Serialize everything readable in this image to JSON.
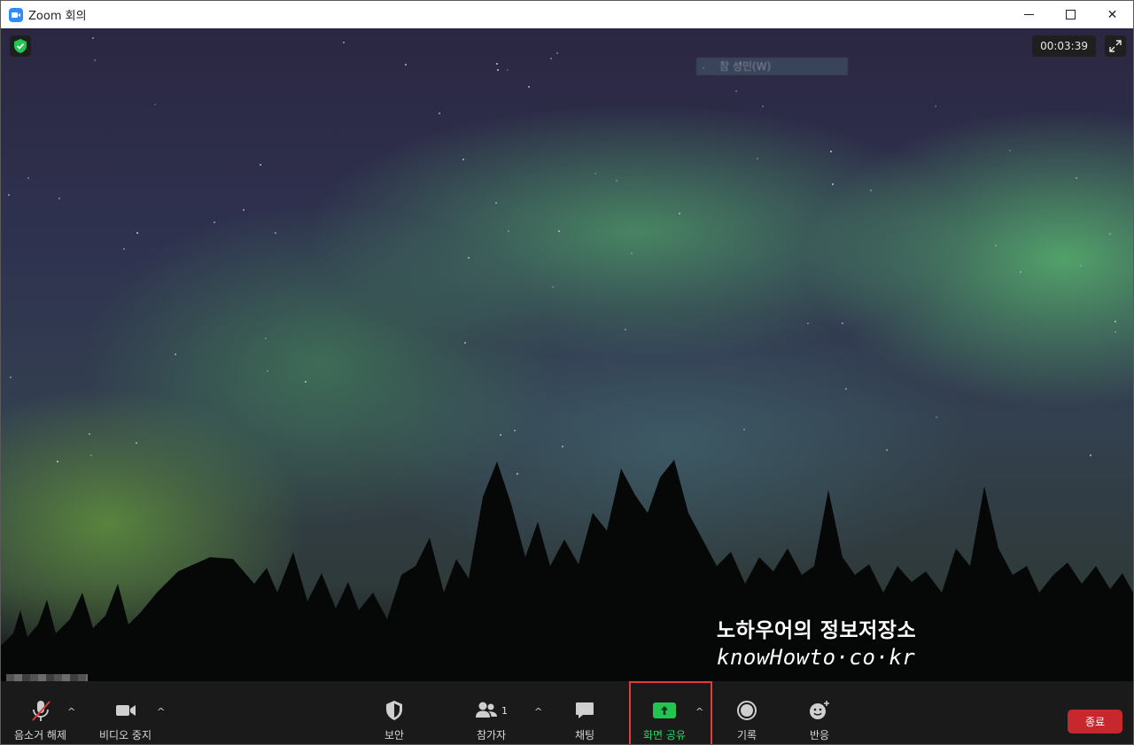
{
  "window": {
    "title": "Zoom 회의"
  },
  "video": {
    "blurred_name": "참 성민(W)",
    "timer": "00:03:39",
    "watermark_line1": "노하우어의 정보저장소",
    "watermark_line2": "knowHowto·co·kr"
  },
  "toolbar": {
    "mute_label": "음소거 해제",
    "video_label": "비디오 중지",
    "security_label": "보안",
    "participants_label": "참가자",
    "participants_count": "1",
    "chat_label": "채팅",
    "share_label": "화면 공유",
    "record_label": "기록",
    "reactions_label": "반응",
    "end_label": "종료"
  },
  "colors": {
    "share_accent": "#23c552",
    "end_button": "#c7282e",
    "highlight_box": "#e23b3b",
    "toolbar_bg": "#1a1a1a"
  }
}
